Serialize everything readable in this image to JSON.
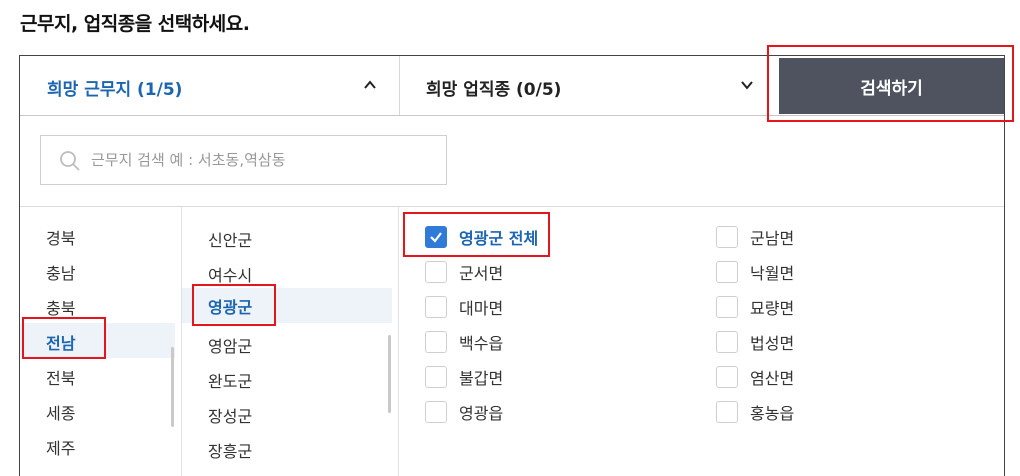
{
  "page_title": "근무지, 업직종을 선택하세요.",
  "tabs": {
    "region_label": "희망 근무지 (1/5)",
    "job_label": "희망 업직종 (0/5)"
  },
  "search_button_label": "검색하기",
  "search": {
    "placeholder": "근무지 검색 예 : 서초동,역삼동",
    "value": ""
  },
  "provinces": [
    {
      "label": "경북",
      "selected": false
    },
    {
      "label": "충남",
      "selected": false
    },
    {
      "label": "충북",
      "selected": false
    },
    {
      "label": "전남",
      "selected": true
    },
    {
      "label": "전북",
      "selected": false
    },
    {
      "label": "세종",
      "selected": false
    },
    {
      "label": "제주",
      "selected": false
    }
  ],
  "districts": [
    {
      "label": "신안군",
      "selected": false
    },
    {
      "label": "여수시",
      "selected": false
    },
    {
      "label": "영광군",
      "selected": true
    },
    {
      "label": "영암군",
      "selected": false
    },
    {
      "label": "완도군",
      "selected": false
    },
    {
      "label": "장성군",
      "selected": false
    },
    {
      "label": "장흥군",
      "selected": false
    }
  ],
  "towns_left": [
    {
      "label": "영광군 전체",
      "checked": true
    },
    {
      "label": "군서면",
      "checked": false
    },
    {
      "label": "대마면",
      "checked": false
    },
    {
      "label": "백수읍",
      "checked": false
    },
    {
      "label": "불갑면",
      "checked": false
    },
    {
      "label": "영광읍",
      "checked": false
    }
  ],
  "towns_right": [
    {
      "label": "군남면",
      "checked": false
    },
    {
      "label": "낙월면",
      "checked": false
    },
    {
      "label": "묘량면",
      "checked": false
    },
    {
      "label": "법성면",
      "checked": false
    },
    {
      "label": "염산면",
      "checked": false
    },
    {
      "label": "홍농읍",
      "checked": false
    }
  ],
  "colors": {
    "accent": "#1c66b1",
    "checkbox": "#2f7bd7",
    "button": "#4e535f",
    "highlight": "#e5161b"
  }
}
